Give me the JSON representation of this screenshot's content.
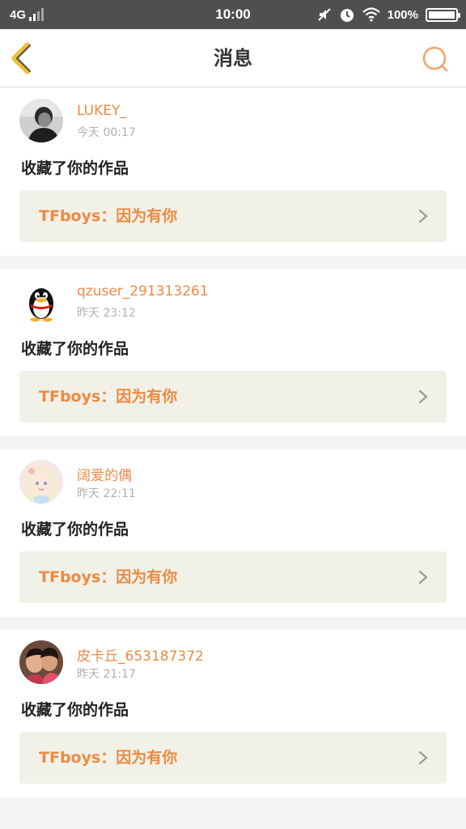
{
  "status_bar": {
    "network": "4G",
    "time": "10:00",
    "battery": "100%",
    "battery_level": 1.0,
    "icons": [
      "mute-icon",
      "alarm-icon",
      "wifi-icon",
      "battery-icon"
    ]
  },
  "header": {
    "title": "消息",
    "back_icon": "chevron-left-icon",
    "search_icon": "search-icon"
  },
  "colors": {
    "accent": "#ec8a43",
    "back_icon": "#f0c030",
    "card_link_bg": "#f2f1e8",
    "status_bar_bg": "#4f4f4f"
  },
  "messages": [
    {
      "username": "LUKEY_",
      "time": "今天 00:17",
      "action": "收藏了你的作品",
      "work_title": "TFboys：因为有你"
    },
    {
      "username": "qzuser_291313261",
      "time": "昨天 23:12",
      "action": "收藏了你的作品",
      "work_title": "TFboys：因为有你"
    },
    {
      "username": "阔爱的偶",
      "time": "昨天 22:11",
      "action": "收藏了你的作品",
      "work_title": "TFboys：因为有你"
    },
    {
      "username": "皮卡丘_653187372",
      "time": "昨天 21:17",
      "action": "收藏了你的作品",
      "work_title": "TFboys：因为有你"
    }
  ]
}
